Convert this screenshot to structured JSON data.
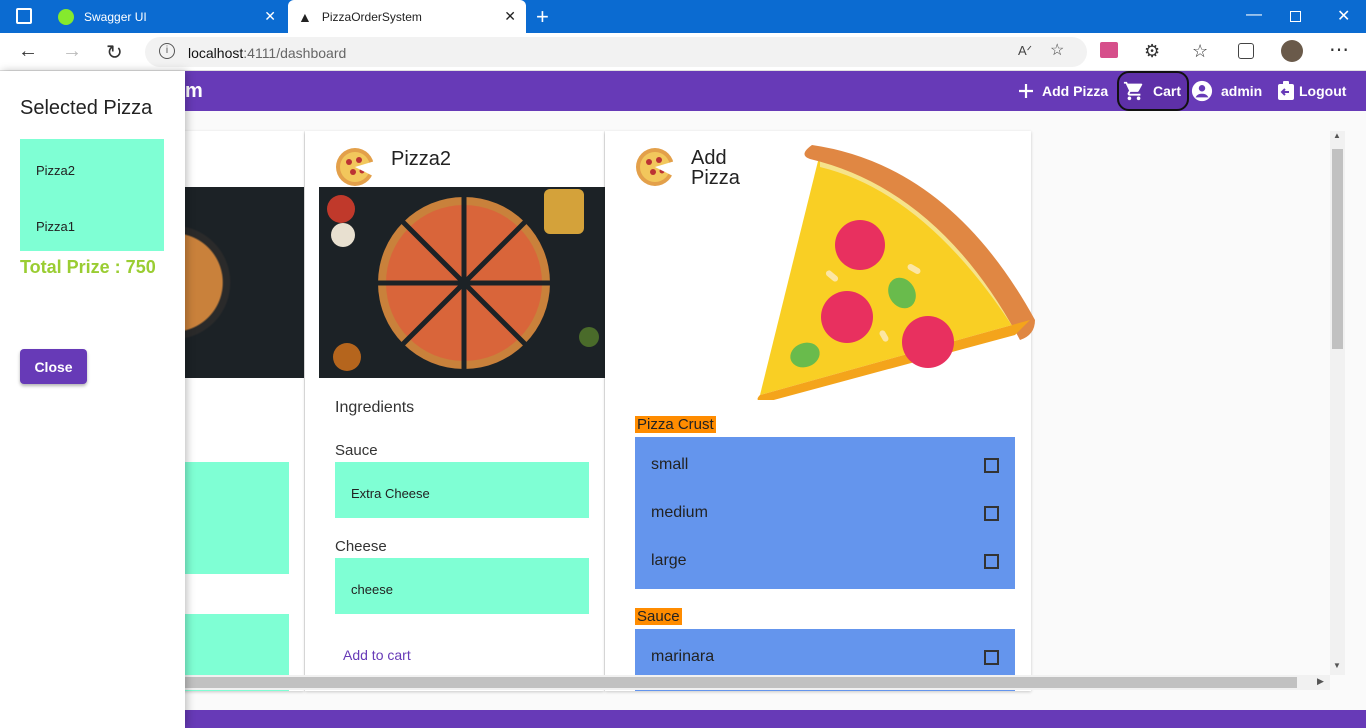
{
  "browser": {
    "tabs": [
      {
        "label": "Swagger UI",
        "active": false
      },
      {
        "label": "PizzaOrderSystem",
        "active": true
      }
    ],
    "url": "localhost:4111/dashboard",
    "url_host": "localhost",
    "url_rest": ":4111/dashboard"
  },
  "toolbar": {
    "title_fragment": "m",
    "add_pizza": "Add Pizza",
    "cart": "Cart",
    "user": "admin",
    "logout": "Logout",
    "color": "#673ab7"
  },
  "drawer": {
    "title": "Selected Pizza",
    "items": [
      "Pizza2",
      "Pizza1"
    ],
    "total": "Total Prize : 750",
    "close": "Close"
  },
  "pizza_card": {
    "title": "Pizza2",
    "ingredients_heading": "Ingredients",
    "sauce_label": "Sauce",
    "sauce_value": "Extra Cheese",
    "cheese_label": "Cheese",
    "cheese_value": "cheese",
    "add_to_cart": "Add to cart"
  },
  "add_card": {
    "title_line1": "Add",
    "title_line2": "Pizza",
    "crust_label": "Pizza Crust",
    "crust_options": [
      "small",
      "medium",
      "large"
    ],
    "sauce_label": "Sauce",
    "sauce_options": [
      "marinara"
    ]
  },
  "colors": {
    "accent": "#673ab7",
    "mint": "#7fffd4",
    "total_green": "#9acd32",
    "option_blue": "#6495ed",
    "label_orange": "#ff8c00"
  }
}
